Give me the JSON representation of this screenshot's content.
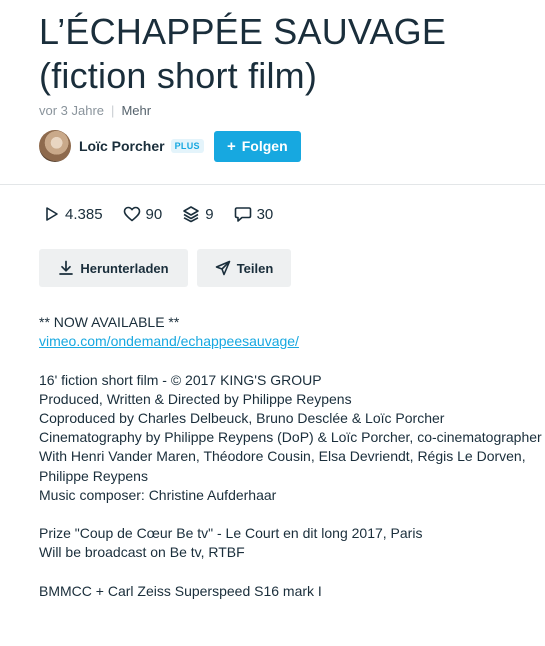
{
  "video": {
    "title": "L’ÉCHAPPÉE SAUVAGE (fiction short film)",
    "age": "vor 3 Jahre",
    "more_label": "Mehr"
  },
  "author": {
    "name": "Loïc Porcher",
    "badge": "PLUS",
    "follow_label": "Folgen",
    "follow_icon": "plus-icon"
  },
  "stats": {
    "plays": "4.385",
    "likes": "90",
    "collections": "9",
    "comments": "30"
  },
  "actions": {
    "download_label": "Herunterladen",
    "share_label": "Teilen"
  },
  "description": {
    "line1": "** NOW AVAILABLE **",
    "link": "vimeo.com/ondemand/echappeesauvage/",
    "line3": "16' fiction short film - © 2017 KING'S GROUP",
    "line4": "Produced, Written & Directed by Philippe Reypens",
    "line5": "Coproduced by Charles Delbeuck, Bruno Desclée & Loïc Porcher",
    "line6": "Cinematography by Philippe Reypens (DoP) & Loïc Porcher, co-cinematographer",
    "line7": "With Henri Vander Maren, Théodore Cousin, Elsa Devriendt, Régis Le Dorven, Philippe Reypens",
    "line8": "Music composer: Christine Aufderhaar",
    "line9": "Prize \"Coup de Cœur Be tv\" - Le Court en dit long 2017, Paris",
    "line10": "Will be broadcast on Be tv, RTBF",
    "line11": "BMMCC + Carl Zeiss Superspeed S16 mark I"
  },
  "colors": {
    "accent": "#17a8e0",
    "text": "#1a2e3b",
    "muted": "#8a949c",
    "button_bg": "#eef0f1"
  }
}
